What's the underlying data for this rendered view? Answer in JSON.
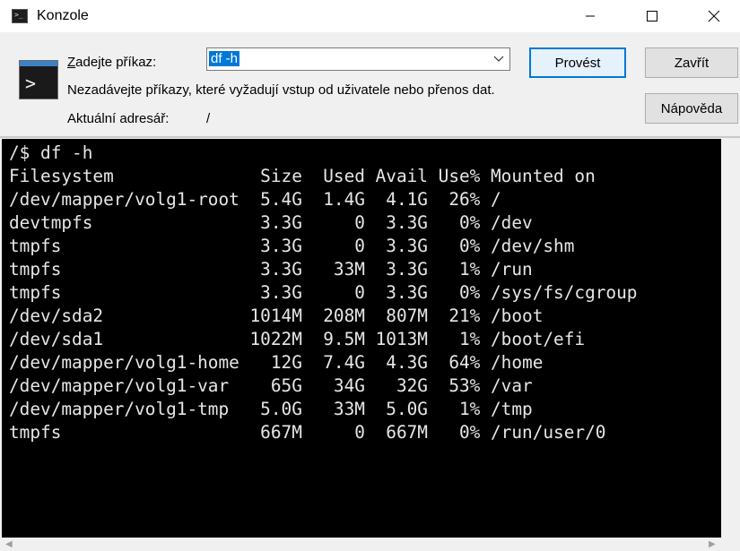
{
  "window": {
    "title": "Konzole",
    "icon": "console-icon",
    "controls": {
      "minimize": "minimize-icon",
      "maximize": "maximize-icon",
      "close": "close-icon"
    }
  },
  "form": {
    "command_label_accesskey": "Z",
    "command_label_rest": "adejte příkaz:",
    "command_value": "df -h",
    "hint": "Nezadávejte příkazy, které vyžadují vstup od uživatele nebo přenos dat.",
    "dir_label": "Aktuální adresář:",
    "dir_value": "/"
  },
  "buttons": {
    "run": "Provést",
    "close": "Zavřít",
    "help": "Nápověda"
  },
  "terminal": {
    "prompt": "/$ df -h",
    "header": "Filesystem              Size  Used Avail Use% Mounted on",
    "lines": [
      "/dev/mapper/volg1-root  5.4G  1.4G  4.1G  26% /",
      "devtmpfs                3.3G     0  3.3G   0% /dev",
      "tmpfs                   3.3G     0  3.3G   0% /dev/shm",
      "tmpfs                   3.3G   33M  3.3G   1% /run",
      "tmpfs                   3.3G     0  3.3G   0% /sys/fs/cgroup",
      "/dev/sda2              1014M  208M  807M  21% /boot",
      "/dev/sda1              1022M  9.5M 1013M   1% /boot/efi",
      "/dev/mapper/volg1-home   12G  7.4G  4.3G  64% /home",
      "/dev/mapper/volg1-var    65G   34G   32G  53% /var",
      "/dev/mapper/volg1-tmp   5.0G   33M  5.0G   1% /tmp",
      "tmpfs                   667M     0  667M   0% /run/user/0"
    ]
  },
  "colors": {
    "accent": "#0078d7",
    "terminal_bg": "#000000",
    "terminal_fg": "#e6e6e6"
  }
}
